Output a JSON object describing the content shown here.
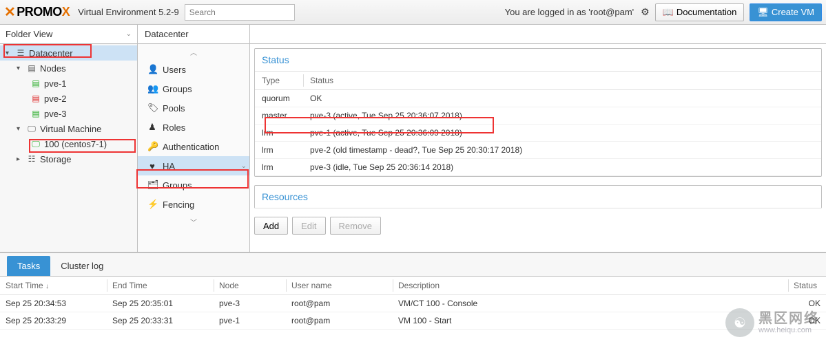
{
  "header": {
    "logo_pre": "PRO",
    "logo_mid": "MO",
    "logo_end": "X",
    "product": "Virtual Environment 5.2-9",
    "search_placeholder": "Search",
    "login_text": "You are logged in as 'root@pam'",
    "doc_label": "Documentation",
    "create_vm_label": "Create VM"
  },
  "sidebar": {
    "view_label": "Folder View",
    "items": [
      {
        "label": "Datacenter"
      },
      {
        "label": "Nodes"
      },
      {
        "label": "pve-1"
      },
      {
        "label": "pve-2"
      },
      {
        "label": "pve-3"
      },
      {
        "label": "Virtual Machine"
      },
      {
        "label": "100 (centos7-1)"
      },
      {
        "label": "Storage"
      }
    ]
  },
  "config": {
    "breadcrumb": "Datacenter",
    "items": [
      {
        "label": "Users"
      },
      {
        "label": "Groups"
      },
      {
        "label": "Pools"
      },
      {
        "label": "Roles"
      },
      {
        "label": "Authentication"
      },
      {
        "label": "HA"
      },
      {
        "label": "Groups"
      },
      {
        "label": "Fencing"
      }
    ]
  },
  "status_panel": {
    "title": "Status",
    "col_type": "Type",
    "col_status": "Status",
    "rows": [
      {
        "type": "quorum",
        "status": "OK"
      },
      {
        "type": "master",
        "status": "pve-3 (active, Tue Sep 25 20:36:07 2018)"
      },
      {
        "type": "lrm",
        "status": "pve-1 (active, Tue Sep 25 20:36:09 2018)"
      },
      {
        "type": "lrm",
        "status": "pve-2 (old timestamp - dead?, Tue Sep 25 20:30:17 2018)"
      },
      {
        "type": "lrm",
        "status": "pve-3 (idle, Tue Sep 25 20:36:14 2018)"
      }
    ]
  },
  "resources_panel": {
    "title": "Resources",
    "btn_add": "Add",
    "btn_edit": "Edit",
    "btn_remove": "Remove"
  },
  "logs": {
    "tab_tasks": "Tasks",
    "tab_cluster": "Cluster log",
    "cols": {
      "start": "Start Time",
      "end": "End Time",
      "node": "Node",
      "user": "User name",
      "desc": "Description",
      "status": "Status"
    },
    "rows": [
      {
        "start": "Sep 25 20:34:53",
        "end": "Sep 25 20:35:01",
        "node": "pve-3",
        "user": "root@pam",
        "desc": "VM/CT 100 - Console",
        "status": "OK"
      },
      {
        "start": "Sep 25 20:33:29",
        "end": "Sep 25 20:33:31",
        "node": "pve-1",
        "user": "root@pam",
        "desc": "VM 100 - Start",
        "status": "OK"
      }
    ]
  },
  "watermark": {
    "cn": "黑区网络",
    "url": "www.heiqu.com"
  }
}
